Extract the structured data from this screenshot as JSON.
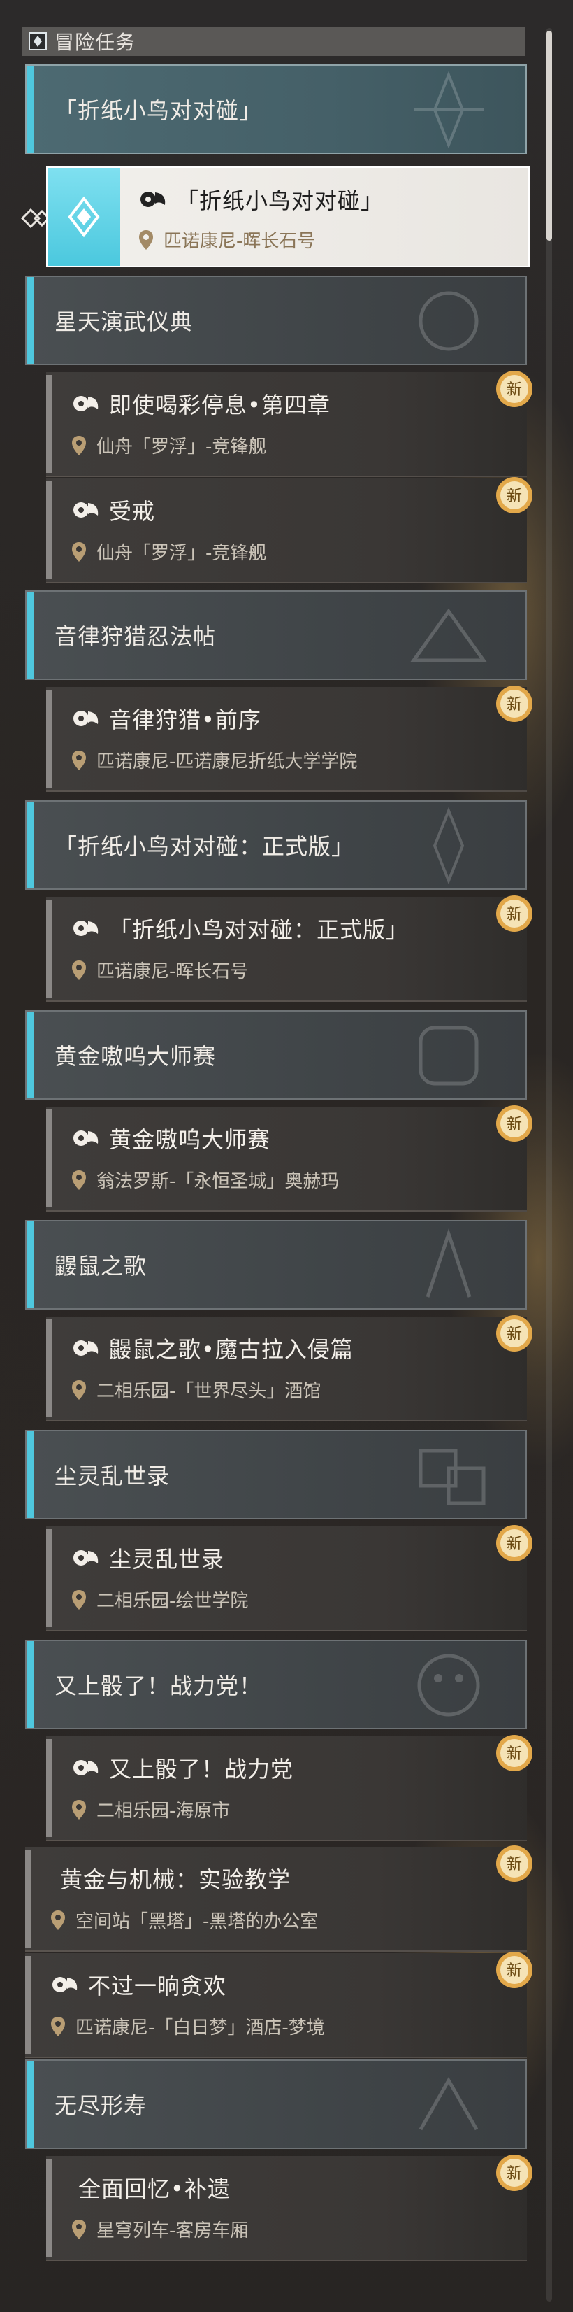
{
  "header": {
    "title": "冒险任务"
  },
  "colors": {
    "accent": "#4fc7de",
    "new_badge": "#e2a84a",
    "location_text": "#cbc4b8"
  },
  "groups": [
    {
      "title": "「折纸小鸟对对碰」",
      "selected": true
    },
    {
      "title": "星天演武仪典"
    },
    {
      "title": "音律狩猎忍法帖"
    },
    {
      "title": "「折纸小鸟对对碰：正式版」"
    },
    {
      "title": "黄金嗷呜大师赛"
    },
    {
      "title": "鼹鼠之歌"
    },
    {
      "title": "尘灵乱世录"
    },
    {
      "title": "又上骰了！战力党！"
    },
    {
      "title": "无尽形寿"
    }
  ],
  "quests": [
    {
      "title": "「折纸小鸟对对碰」",
      "location": "匹诺康尼-晖长石号",
      "selected": true,
      "new": false
    },
    {
      "title": "即使喝彩停息•第四章",
      "location": "仙舟「罗浮」-竞锋舰",
      "new": true
    },
    {
      "title": "受戒",
      "location": "仙舟「罗浮」-竞锋舰",
      "new": true
    },
    {
      "title": "音律狩猎•前序",
      "location": "匹诺康尼-匹诺康尼折纸大学学院",
      "new": true
    },
    {
      "title": "「折纸小鸟对对碰：正式版」",
      "location": "匹诺康尼-晖长石号",
      "new": true
    },
    {
      "title": "黄金嗷呜大师赛",
      "location": "翁法罗斯-「永恒圣城」奥赫玛",
      "new": true
    },
    {
      "title": "鼹鼠之歌•魔古拉入侵篇",
      "location": "二相乐园-「世界尽头」酒馆",
      "new": true
    },
    {
      "title": "尘灵乱世录",
      "location": "二相乐园-绘世学院",
      "new": true
    },
    {
      "title": "又上骰了！战力党",
      "location": "二相乐园-海原市",
      "new": true
    },
    {
      "title": "黄金与机械：实验教学",
      "location": "空间站「黑塔」-黑塔的办公室",
      "new": true
    },
    {
      "title": "不过一晌贪欢",
      "location": "匹诺康尼-「白日梦」酒店-梦境",
      "new": true
    },
    {
      "title": "全面回忆•补遗",
      "location": "星穹列车-客房车厢",
      "new": true
    }
  ],
  "badges": {
    "new_label": "新"
  },
  "icons": {
    "header": "diamond-icon",
    "quest": "quest-type-icon",
    "location": "location-pin-icon",
    "new": "new-badge-icon",
    "selection": "selection-arrow-icon"
  }
}
